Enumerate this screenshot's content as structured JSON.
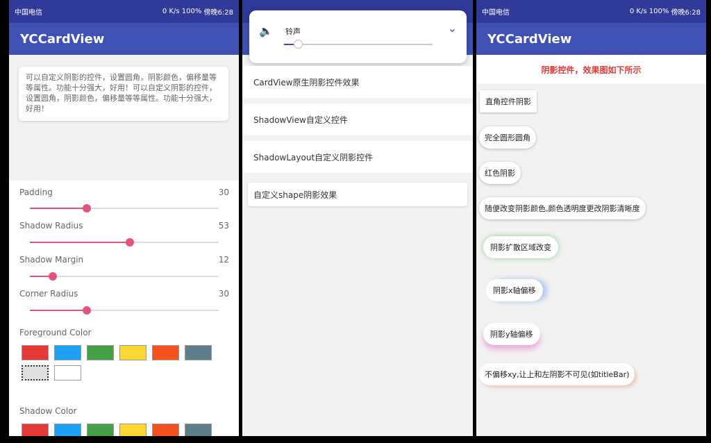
{
  "status": {
    "carrier": "中国电信",
    "speed": "0 K/s",
    "battery": "100%",
    "time": "傍晚6:28"
  },
  "phone1": {
    "title": "YCCardView",
    "description": "可以自定义阴影的控件，设置圆角，阴影颜色，偏移量等等属性。功能十分强大，好用！可以自定义阴影的控件，设置圆角，阴影颜色，偏移量等等属性。功能十分强大，好用！",
    "sliders": [
      {
        "label": "Padding",
        "value": "30",
        "fraction": 0.3
      },
      {
        "label": "Shadow Radius",
        "value": "53",
        "fraction": 0.53
      },
      {
        "label": "Shadow Margin",
        "value": "12",
        "fraction": 0.12
      },
      {
        "label": "Corner Radius",
        "value": "30",
        "fraction": 0.3
      }
    ],
    "foreground_label": "Foreground Color",
    "shadow_label": "Shadow Color",
    "colors": [
      "#e53935",
      "#1ea1f2",
      "#43a047",
      "#fdd835",
      "#f4511e",
      "#607d8b",
      "#e0e0e0",
      "#ffffff"
    ],
    "accent": "#e5537a"
  },
  "phone2": {
    "volume_title": "铃声",
    "items": [
      "CardView原生阴影控件效果",
      "ShadowView自定义控件",
      "ShadowLayout自定义阴影控件",
      "自定义shape阴影效果"
    ]
  },
  "phone3": {
    "title": "YCCardView",
    "header": "阴影控件，效果图如下所示",
    "items": [
      "直角控件阴影",
      "完全圆形圆角",
      "红色阴影",
      "随便改变阴影颜色,颜色透明度更改阴影清晰度",
      "阴影扩散区域改变",
      "阴影x轴偏移",
      "阴影y轴偏移",
      "不偏移xy,让上和左阴影不可见(如titleBar)"
    ]
  }
}
